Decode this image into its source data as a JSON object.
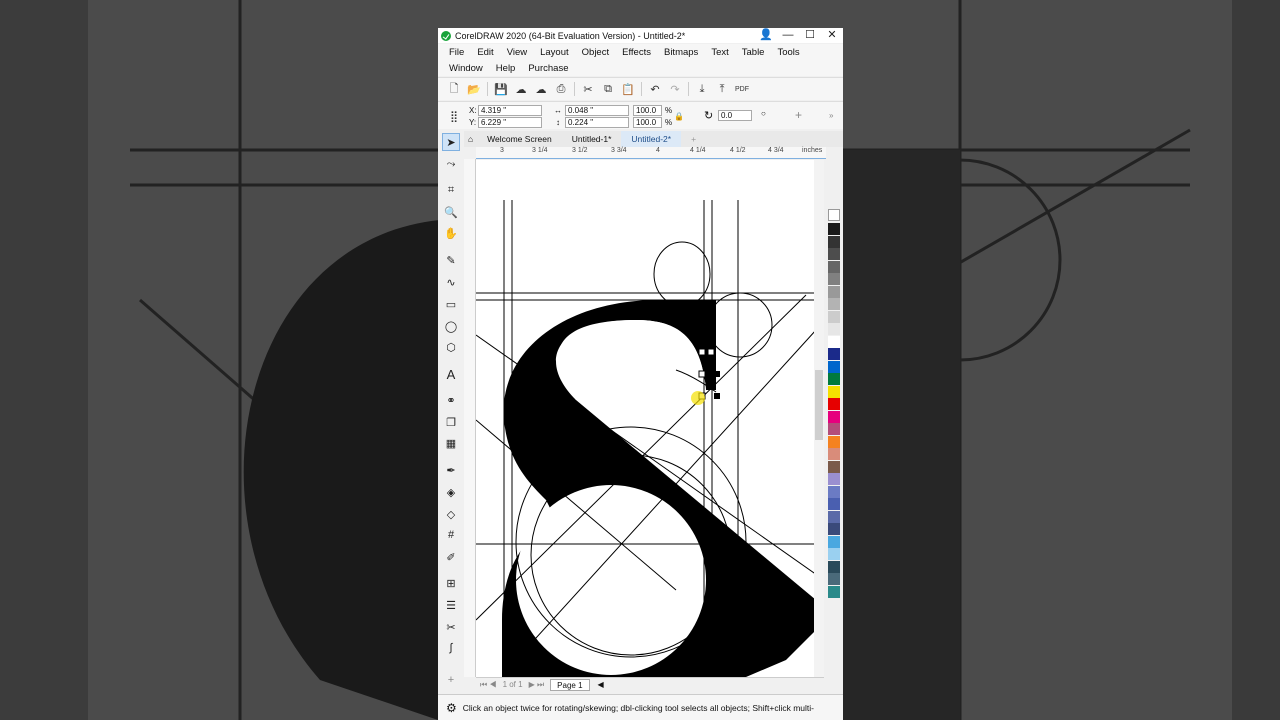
{
  "window": {
    "title": "CorelDRAW 2020 (64-Bit Evaluation Version) - Untitled-2*",
    "controls": [
      "—",
      "☐",
      "✕"
    ]
  },
  "menus": {
    "row1": [
      "File",
      "Edit",
      "View",
      "Layout",
      "Object",
      "Effects",
      "Bitmaps",
      "Text",
      "Table",
      "Tools"
    ],
    "row2": [
      "Window",
      "Help",
      "Purchase"
    ]
  },
  "property_bar": {
    "x_label": "X:",
    "x_value": "4.319 \"",
    "y_label": "Y:",
    "y_value": "6.229 \"",
    "w_value": "0.048 \"",
    "h_value": "0.224 \"",
    "scale_w": "100.0",
    "scale_h": "100.0",
    "percent": "%",
    "rotation": "0.0"
  },
  "doc_tabs": [
    "Welcome Screen",
    "Untitled-1*",
    "Untitled-2*"
  ],
  "ruler": {
    "units": "inches",
    "ticks": [
      "3",
      "3 1/4",
      "3 1/2",
      "3 3/4",
      "4",
      "4 1/4",
      "4 1/2",
      "4 3/4"
    ]
  },
  "page_nav": {
    "page_counter": "1 of 1",
    "page_tab": "Page 1"
  },
  "status": {
    "hint": "Click an object twice for rotating/skewing; dbl-clicking tool selects all objects; Shift+click multi-"
  },
  "colors": {
    "accent": "#1f7fd0",
    "palette": [
      "#1a1a1a",
      "#333333",
      "#4d4d4d",
      "#666666",
      "#808080",
      "#999999",
      "#b3b3b3",
      "#cccccc",
      "#e6e6e6",
      "#ffffff",
      "#1b2a8a",
      "#0066cc",
      "#007a3d",
      "#f5e000",
      "#e60000",
      "#e6007e",
      "#b34d7a",
      "#f58220",
      "#d98c7a",
      "#7a5a4a",
      "#9a8fd0",
      "#6b7bc4",
      "#4a5fb0",
      "#5a6aa8",
      "#3a4a7a",
      "#4aa8e0",
      "#9ad0f0",
      "#2a4a5a",
      "#4a6a7a",
      "#2a8a8a"
    ]
  }
}
